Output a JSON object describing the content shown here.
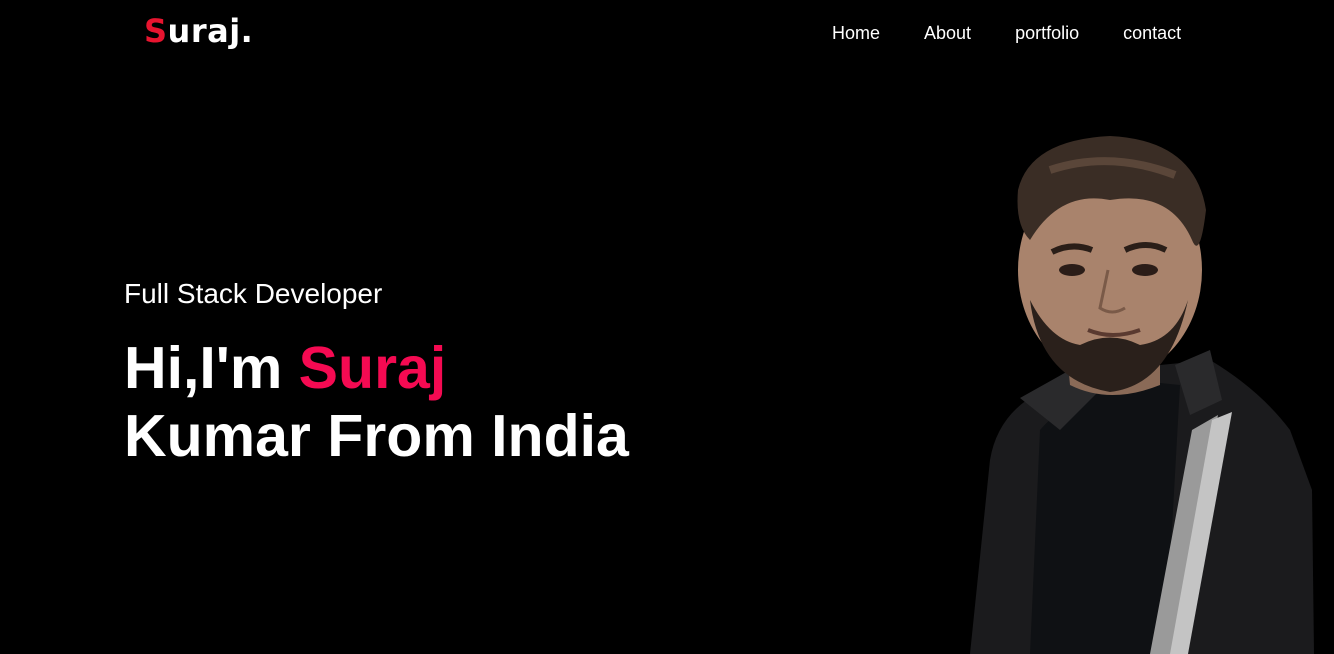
{
  "header": {
    "logo_first": "S",
    "logo_rest": "uraj.",
    "nav": [
      {
        "label": "Home"
      },
      {
        "label": "About"
      },
      {
        "label": "portfolio"
      },
      {
        "label": "contact"
      }
    ]
  },
  "hero": {
    "subtitle": "Full Stack Developer",
    "greeting": "Hi,I'm ",
    "name": "Suraj",
    "line2": "Kumar From India"
  },
  "colors": {
    "background": "#000000",
    "logo_accent": "#e8142f",
    "name_accent": "#f50a52",
    "text": "#ffffff"
  },
  "portrait": {
    "icon": "person-photo"
  }
}
